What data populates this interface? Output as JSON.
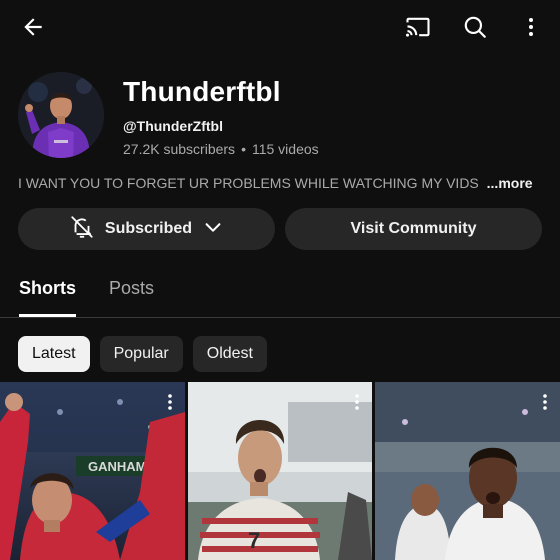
{
  "channel": {
    "name": "Thunderftbl",
    "handle": "@ThunderZftbl",
    "subscribers": "27.2K subscribers",
    "separator": "•",
    "videos": "115 videos",
    "description": "I WANT YOU TO FORGET UR PROBLEMS WHILE WATCHING MY VIDS",
    "more_label": "...more"
  },
  "actions": {
    "subscribed_label": "Subscribed",
    "community_label": "Visit Community"
  },
  "tabs": [
    {
      "label": "Shorts",
      "active": true
    },
    {
      "label": "Posts",
      "active": false
    }
  ],
  "chips": [
    {
      "label": "Latest",
      "active": true
    },
    {
      "label": "Popular",
      "active": false
    },
    {
      "label": "Oldest",
      "active": false
    }
  ],
  "thumbnails": [
    {
      "banner_text": "GANHAMOS"
    },
    {
      "jersey_number": "7"
    },
    {}
  ],
  "icons": [
    "back-arrow-icon",
    "cast-icon",
    "search-icon",
    "more-vert-icon",
    "bell-off-icon",
    "chevron-down-icon"
  ],
  "colors": {
    "background": "#0f0f0f",
    "button_bg": "#272727",
    "text_primary": "#f1f1f1",
    "text_secondary": "#aaaaaa",
    "chip_active_bg": "#f1f1f1"
  }
}
